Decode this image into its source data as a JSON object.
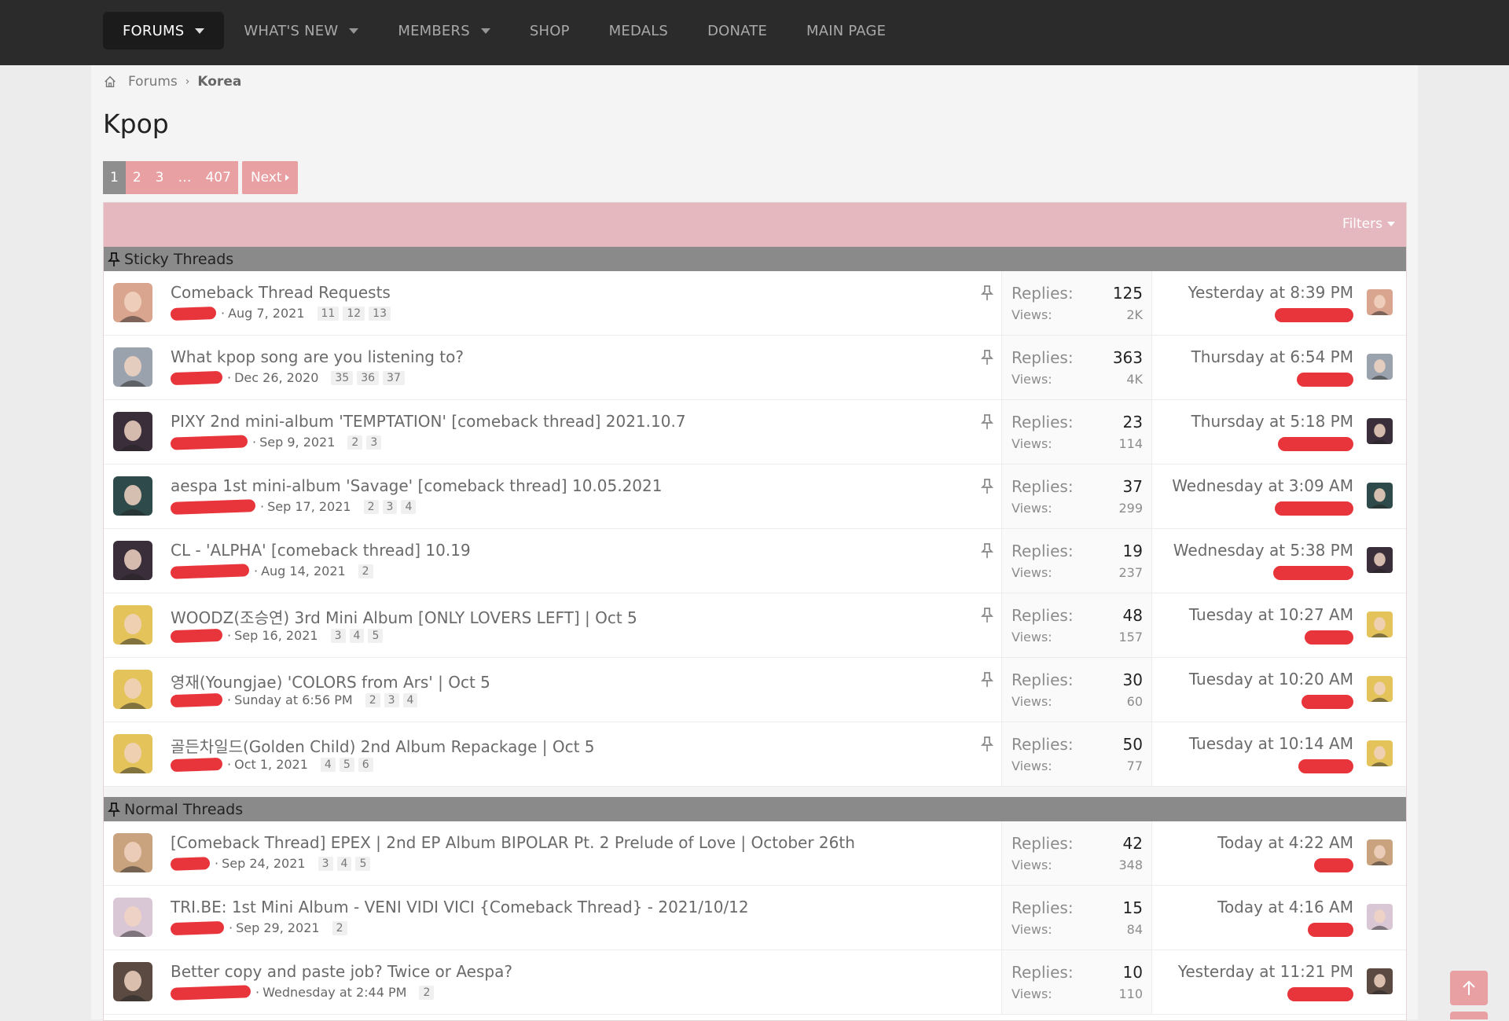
{
  "nav": {
    "items": [
      {
        "label": "FORUMS",
        "active": true,
        "caret": true
      },
      {
        "label": "WHAT'S NEW",
        "active": false,
        "caret": true
      },
      {
        "label": "MEMBERS",
        "active": false,
        "caret": true
      },
      {
        "label": "SHOP",
        "active": false,
        "caret": false
      },
      {
        "label": "MEDALS",
        "active": false,
        "caret": false
      },
      {
        "label": "DONATE",
        "active": false,
        "caret": false
      },
      {
        "label": "MAIN PAGE",
        "active": false,
        "caret": false
      }
    ]
  },
  "breadcrumb": {
    "home_icon": "home-icon",
    "forums": "Forums",
    "current": "Korea"
  },
  "page_title": "Kpop",
  "pagination": {
    "pages": [
      "1",
      "2",
      "3",
      "…",
      "407"
    ],
    "current": "1",
    "next": "Next"
  },
  "filters_label": "Filters",
  "sections": {
    "sticky": "Sticky Threads",
    "normal": "Normal Threads"
  },
  "labels": {
    "replies": "Replies:",
    "views": "Views:"
  },
  "colors": {
    "accent": "#e8a0a3",
    "filterbar": "#e5b8bf",
    "redaction": "#e8353b",
    "topbar": "#2b2b2b"
  },
  "sticky_threads": [
    {
      "title": "Comeback Thread Requests",
      "date": "Aug 7, 2021",
      "pages": [
        "11",
        "12",
        "13"
      ],
      "replies": "125",
      "views": "2K",
      "last": "Yesterday at 8:39 PM",
      "avatar": "#d9a58f"
    },
    {
      "title": "What kpop song are you listening to?",
      "date": "Dec 26, 2020",
      "pages": [
        "35",
        "36",
        "37"
      ],
      "replies": "363",
      "views": "4K",
      "last": "Thursday at 6:54 PM",
      "avatar": "#9aa3ad"
    },
    {
      "title": "PIXY 2nd mini-album 'TEMPTATION' [comeback thread] 2021.10.7",
      "date": "Sep 9, 2021",
      "pages": [
        "2",
        "3"
      ],
      "replies": "23",
      "views": "114",
      "last": "Thursday at 5:18 PM",
      "avatar": "#3a2e3a"
    },
    {
      "title": "aespa 1st mini-album 'Savage' [comeback thread] 10.05.2021",
      "date": "Sep 17, 2021",
      "pages": [
        "2",
        "3",
        "4"
      ],
      "replies": "37",
      "views": "299",
      "last": "Wednesday at 3:09 AM",
      "avatar": "#2f4a4a"
    },
    {
      "title": "CL - 'ALPHA' [comeback thread] 10.19",
      "date": "Aug 14, 2021",
      "pages": [
        "2"
      ],
      "replies": "19",
      "views": "237",
      "last": "Wednesday at 5:38 PM",
      "avatar": "#3a2e3a"
    },
    {
      "title": "WOODZ(조승연) 3rd Mini Album [ONLY LOVERS LEFT] | Oct 5",
      "date": "Sep 16, 2021",
      "pages": [
        "3",
        "4",
        "5"
      ],
      "replies": "48",
      "views": "157",
      "last": "Tuesday at 10:27 AM",
      "avatar": "#e3c35a"
    },
    {
      "title": "영재(Youngjae) 'COLORS from Ars' | Oct 5",
      "date": "Sunday at 6:56 PM",
      "pages": [
        "2",
        "3",
        "4"
      ],
      "replies": "30",
      "views": "60",
      "last": "Tuesday at 10:20 AM",
      "avatar": "#e3c35a"
    },
    {
      "title": "골든차일드(Golden Child) 2nd Album Repackage | Oct 5",
      "date": "Oct 1, 2021",
      "pages": [
        "4",
        "5",
        "6"
      ],
      "replies": "50",
      "views": "77",
      "last": "Tuesday at 10:14 AM",
      "avatar": "#e3c35a"
    }
  ],
  "normal_threads": [
    {
      "title": "[Comeback Thread] EPEX | 2nd EP Album BIPOLAR Pt. 2 Prelude of Love | October 26th",
      "date": "Sep 24, 2021",
      "pages": [
        "3",
        "4",
        "5"
      ],
      "replies": "42",
      "views": "348",
      "last": "Today at 4:22 AM",
      "avatar": "#c9a27e"
    },
    {
      "title": "TRI.BE: 1st Mini Album - VENI VIDI VICI {Comeback Thread} - 2021/10/12",
      "date": "Sep 29, 2021",
      "pages": [
        "2"
      ],
      "replies": "15",
      "views": "84",
      "last": "Today at 4:16 AM",
      "avatar": "#d9c7d6"
    },
    {
      "title": "Better copy and paste job? Twice or Aespa?",
      "date": "Wednesday at 2:44 PM",
      "pages": [
        "2"
      ],
      "replies": "10",
      "views": "110",
      "last": "Yesterday at 11:21 PM",
      "avatar": "#5a4a42"
    }
  ],
  "back_to_top_icon": "arrow-up-icon"
}
